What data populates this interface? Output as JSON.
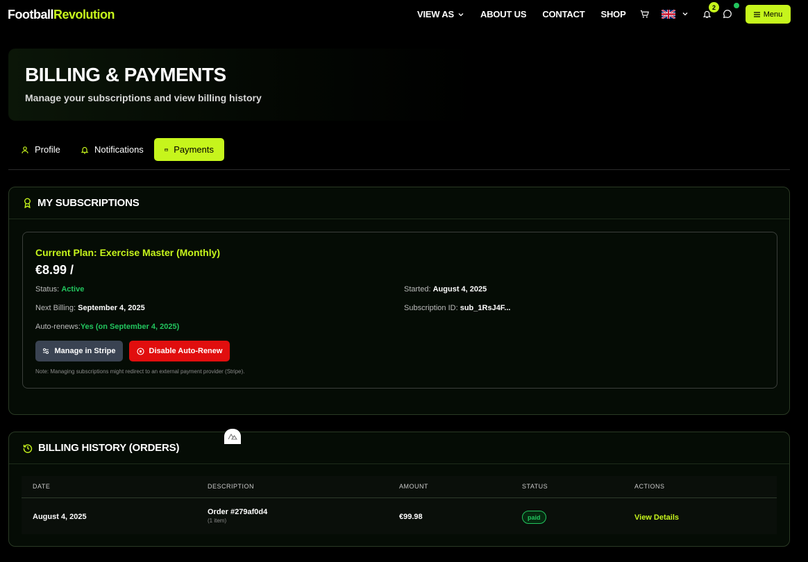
{
  "brand": {
    "left": "Football",
    "right": "Revolution",
    "accent_color": "#c6f51c"
  },
  "nav": {
    "links": [
      "VIEW AS",
      "ABOUT US",
      "CONTACT",
      "SHOP"
    ],
    "notification_count": "2",
    "menu_label": "Menu"
  },
  "header": {
    "title": "BILLING & PAYMENTS",
    "subtitle": "Manage your subscriptions and view billing history"
  },
  "tabs": [
    {
      "label": "Profile",
      "icon": "user-icon",
      "active": false
    },
    {
      "label": "Notifications",
      "icon": "bell-icon",
      "active": false
    },
    {
      "label": "Payments",
      "icon": "credit-card-icon",
      "active": true
    }
  ],
  "subscriptions": {
    "title": "MY SUBSCRIPTIONS",
    "plan_title": "Current Plan: Exercise Master (Monthly)",
    "price": "€8.99 /",
    "status_label": "Status:",
    "status_value": "Active",
    "started_label": "Started:",
    "started_value": "August 4, 2025",
    "next_billing_label": "Next Billing:",
    "next_billing_value": "September 4, 2025",
    "subscription_id_label": "Subscription ID:",
    "subscription_id_value": "sub_1RsJ4F...",
    "auto_renew_label": "Auto-renews:",
    "auto_renew_value": "Yes (on September 4, 2025)",
    "manage_button": "Manage in Stripe",
    "disable_button": "Disable Auto-Renew",
    "note": "Note: Managing subscriptions might redirect to an external payment provider (Stripe)."
  },
  "billing_history": {
    "title": "BILLING HISTORY (ORDERS)",
    "columns": [
      "DATE",
      "DESCRIPTION",
      "AMOUNT",
      "STATUS",
      "ACTIONS"
    ],
    "rows": [
      {
        "date": "August 4, 2025",
        "description": "Order #279af0d4",
        "items": "(1 item)",
        "amount": "€99.98",
        "status": "paid",
        "action": "View Details"
      }
    ]
  },
  "colors": {
    "accent": "#c6f51c",
    "success": "#22c55e",
    "danger": "#e10e0e",
    "secondary_button": "#3a4352"
  }
}
